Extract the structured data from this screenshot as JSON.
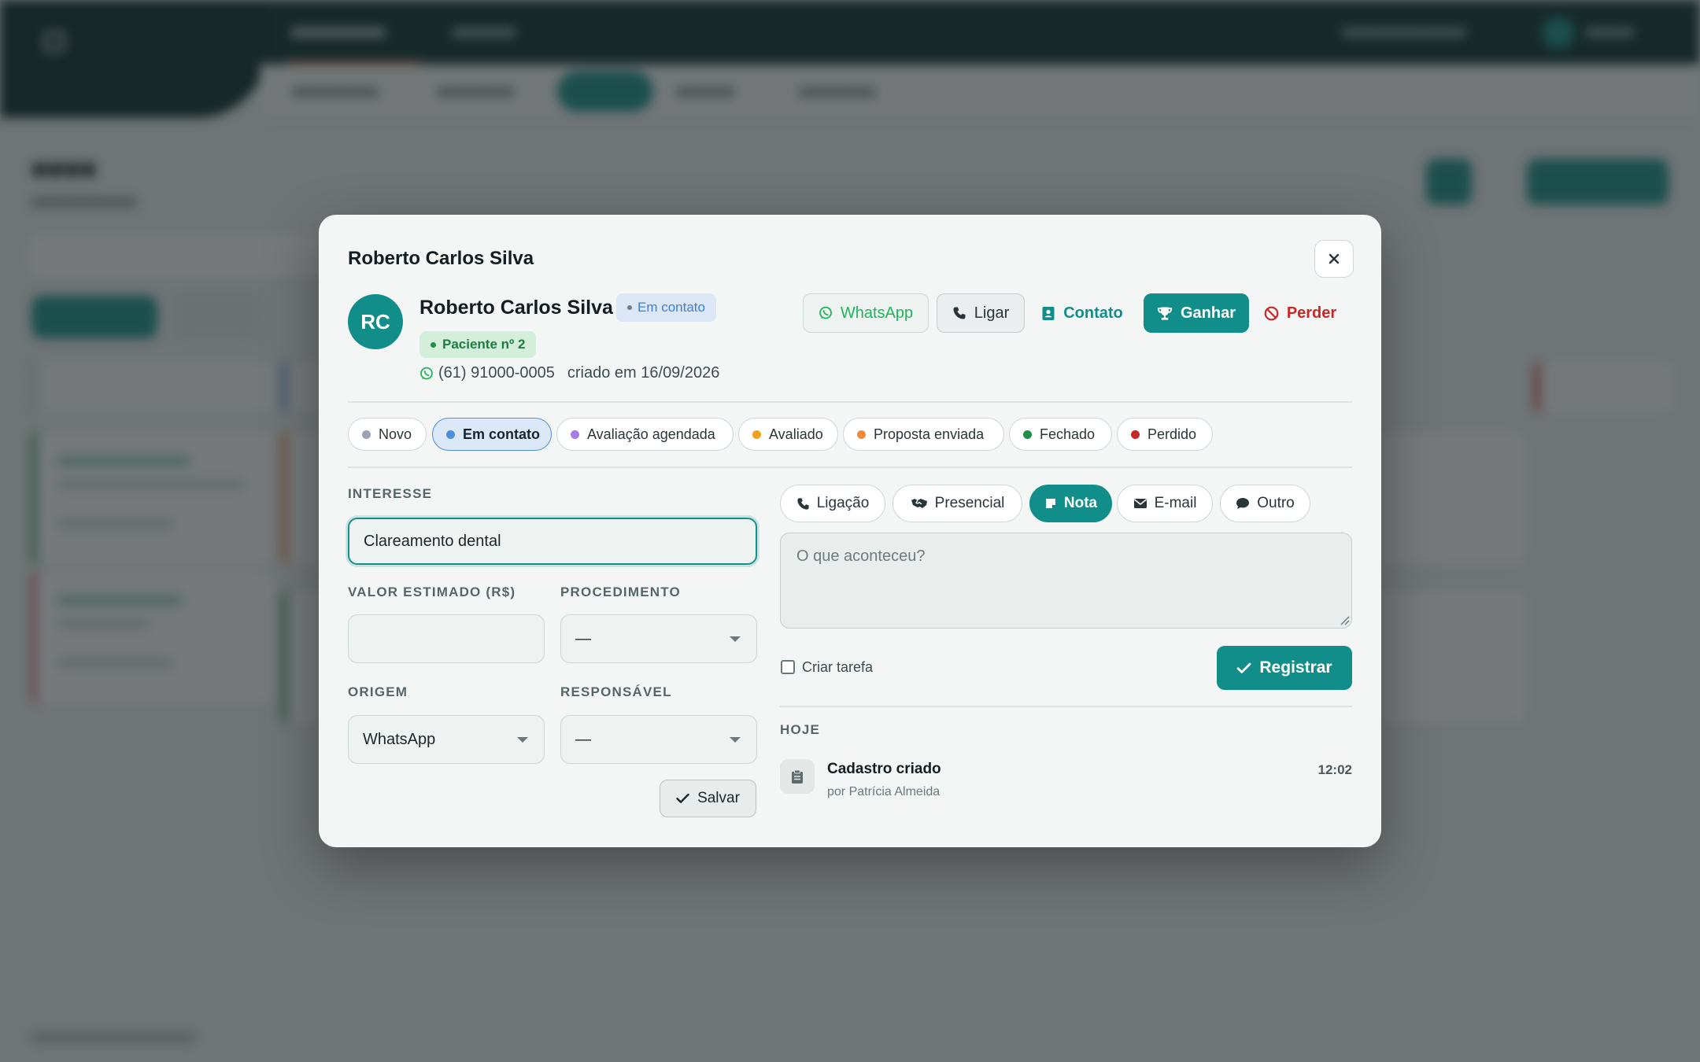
{
  "colors": {
    "accent": "#128e8a",
    "whatsapp": "#21b35b",
    "danger": "#c62828",
    "stage_active_bg": "#dbe8f7"
  },
  "modal": {
    "title": "Roberto Carlos Silva",
    "close_icon": "close-icon"
  },
  "lead": {
    "initials": "RC",
    "name": "Roberto Carlos Silva",
    "status": "Em contato",
    "patient_badge": "Paciente nº 2",
    "phone": "(61) 91000-0005",
    "created": "criado em 16/09/2026"
  },
  "actions": {
    "whatsapp": "WhatsApp",
    "call": "Ligar",
    "contact": "Contato",
    "win": "Ganhar",
    "lose": "Perder"
  },
  "stages": [
    {
      "label": "Novo",
      "color": "#9aa3b5",
      "active": false
    },
    {
      "label": "Em contato",
      "color": "#4f8fe0",
      "active": true
    },
    {
      "label": "Avaliação agendada",
      "color": "#a77be8",
      "active": false
    },
    {
      "label": "Avaliado",
      "color": "#f0a020",
      "active": false
    },
    {
      "label": "Proposta enviada",
      "color": "#f28a3c",
      "active": false
    },
    {
      "label": "Fechado",
      "color": "#1f8f47",
      "active": false
    },
    {
      "label": "Perdido",
      "color": "#c62828",
      "active": false
    }
  ],
  "form": {
    "interest": {
      "label": "INTERESSE",
      "value": "Clareamento dental"
    },
    "estimated_value": {
      "label": "VALOR ESTIMADO (R$)",
      "value": ""
    },
    "procedure": {
      "label": "PROCEDIMENTO",
      "value": "—"
    },
    "origin": {
      "label": "ORIGEM",
      "value": "WhatsApp"
    },
    "owner": {
      "label": "RESPONSÁVEL",
      "value": "—"
    },
    "save": "Salvar"
  },
  "activity": {
    "types": [
      {
        "label": "Ligação",
        "icon": "phone-icon",
        "active": false
      },
      {
        "label": "Presencial",
        "icon": "handshake-icon",
        "active": false
      },
      {
        "label": "Nota",
        "icon": "note-icon",
        "active": true
      },
      {
        "label": "E-mail",
        "icon": "envelope-icon",
        "active": false
      },
      {
        "label": "Outro",
        "icon": "chat-bubble-icon",
        "active": false
      }
    ],
    "placeholder": "O que aconteceu?",
    "create_task": "Criar tarefa",
    "register": "Registrar"
  },
  "timeline": {
    "day": "HOJE",
    "items": [
      {
        "title": "Cadastro criado",
        "by": "por Patrícia Almeida",
        "time": "12:02",
        "icon": "clipboard-icon"
      }
    ]
  }
}
